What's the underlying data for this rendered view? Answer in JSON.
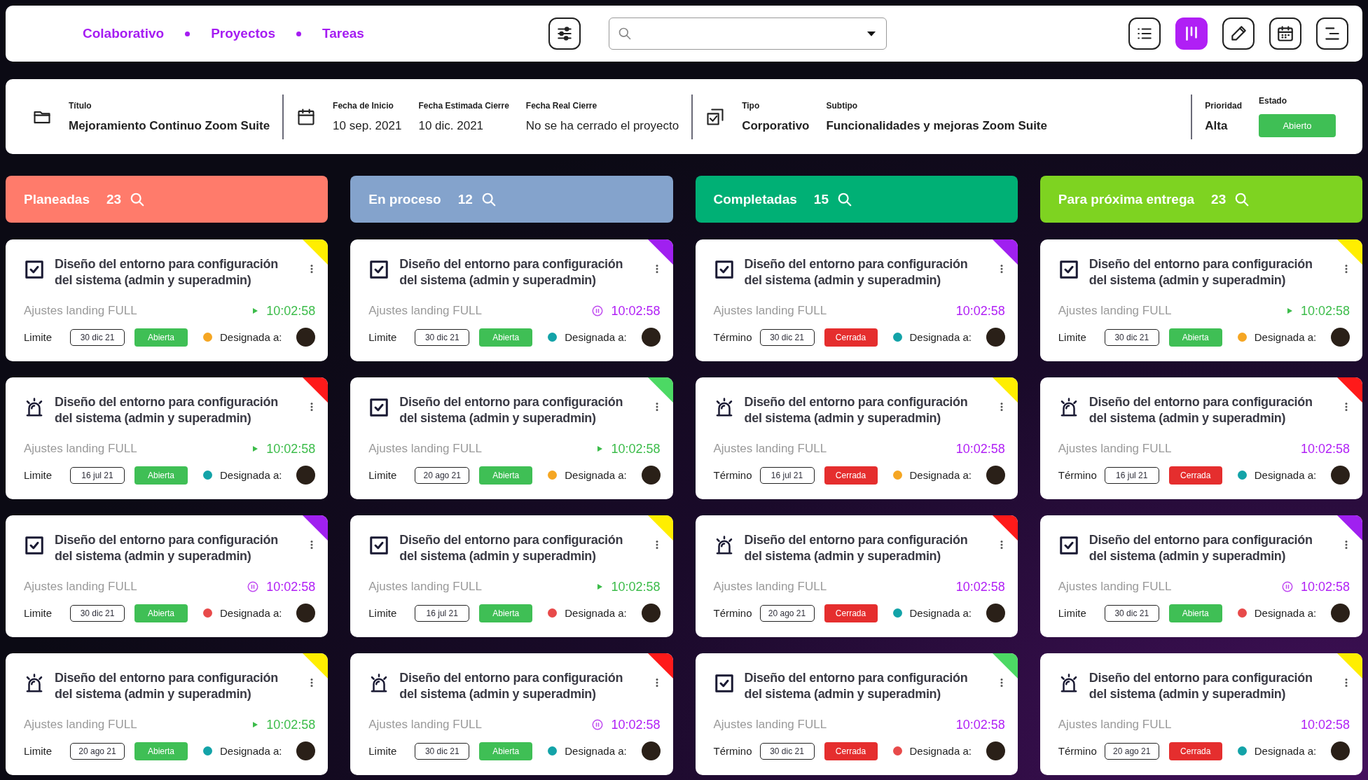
{
  "breadcrumbs": [
    {
      "label": "Colaborativo"
    },
    {
      "label": "Proyectos"
    },
    {
      "label": "Tareas"
    }
  ],
  "views": [
    {
      "kind": "list",
      "selected": false
    },
    {
      "kind": "board",
      "selected": true
    },
    {
      "kind": "edit",
      "selected": false
    },
    {
      "kind": "calendar",
      "selected": false
    },
    {
      "kind": "outline",
      "selected": false
    }
  ],
  "project": {
    "groups": [
      {
        "fields": [
          {
            "label": "Título",
            "value": "Mejoramiento Continuo Zoom Suite"
          }
        ]
      },
      {
        "fields": [
          {
            "label": "Fecha de Inicio",
            "value": "10 sep. 2021"
          },
          {
            "label": "Fecha Estimada Cierre",
            "value": "10 dic. 2021"
          },
          {
            "label": "Fecha Real Cierre",
            "value": "No se ha cerrado el proyecto"
          }
        ]
      },
      {
        "fields": [
          {
            "label": "Tipo",
            "value": "Corporativo"
          },
          {
            "label": "Subtipo",
            "value": "Funcionalidades y mejoras Zoom Suite"
          }
        ]
      },
      {
        "fields": [
          {
            "label": "Prioridad",
            "value": "Alta"
          },
          {
            "label": "Estado",
            "value": "Abierto",
            "kind": "badge"
          }
        ]
      }
    ]
  },
  "columns": [
    {
      "title": "Planeadas",
      "count": "23",
      "color": "#ff7b6b",
      "cards": [
        {
          "kind": "task",
          "flag": {
            "color": "#ffee00"
          },
          "title": "Diseño del entorno para configuración del sistema (admin y superadmin)",
          "subtitle": "Ajustes landing FULL",
          "timer": {
            "kind": "play",
            "time": "10:02:58"
          },
          "date_label": "Limite",
          "date": "30 dic 21",
          "status": {
            "kind": "open",
            "label": "Abierta"
          },
          "assignee": {
            "color": "#f5a623",
            "label": "Designada a:"
          }
        },
        {
          "kind": "alert",
          "flag": {
            "color": "#ff1a1a"
          },
          "title": "Diseño del entorno para configuración del sistema (admin y superadmin)",
          "subtitle": "Ajustes landing FULL",
          "timer": {
            "kind": "play",
            "time": "10:02:58"
          },
          "date_label": "Limite",
          "date": "16 jul 21",
          "status": {
            "kind": "open",
            "label": "Abierta"
          },
          "assignee": {
            "color": "#13a3a8",
            "label": "Designada a:"
          }
        },
        {
          "kind": "task",
          "flag": {
            "color": "#a020f0"
          },
          "title": "Diseño del entorno para configuración del sistema (admin y superadmin)",
          "subtitle": "Ajustes landing FULL",
          "timer": {
            "kind": "pause",
            "time": "10:02:58"
          },
          "date_label": "Limite",
          "date": "30 dic 21",
          "status": {
            "kind": "open",
            "label": "Abierta"
          },
          "assignee": {
            "color": "#e84a4a",
            "label": "Designada a:"
          }
        },
        {
          "kind": "alert",
          "flag": {
            "color": "#ffee00"
          },
          "title": "Diseño del entorno para configuración del sistema (admin y superadmin)",
          "subtitle": "Ajustes landing FULL",
          "timer": {
            "kind": "play",
            "time": "10:02:58"
          },
          "date_label": "Limite",
          "date": "20 ago 21",
          "status": {
            "kind": "open",
            "label": "Abierta"
          },
          "assignee": {
            "color": "#13a3a8",
            "label": "Designada a:"
          }
        }
      ]
    },
    {
      "title": "En proceso",
      "count": "12",
      "color": "#84a3cc",
      "cards": [
        {
          "kind": "task",
          "flag": {
            "color": "#a020f0"
          },
          "title": "Diseño del entorno para configuración del sistema (admin y superadmin)",
          "subtitle": "Ajustes landing FULL",
          "timer": {
            "kind": "pause",
            "time": "10:02:58"
          },
          "date_label": "Limite",
          "date": "30 dic 21",
          "status": {
            "kind": "open",
            "label": "Abierta"
          },
          "assignee": {
            "color": "#13a3a8",
            "label": "Designada a:"
          }
        },
        {
          "kind": "task",
          "flag": {
            "color": "#4cd964"
          },
          "title": "Diseño del entorno para configuración del sistema (admin y superadmin)",
          "subtitle": "Ajustes landing FULL",
          "timer": {
            "kind": "play",
            "time": "10:02:58"
          },
          "date_label": "Limite",
          "date": "20 ago 21",
          "status": {
            "kind": "open",
            "label": "Abierta"
          },
          "assignee": {
            "color": "#f5a623",
            "label": "Designada a:"
          }
        },
        {
          "kind": "task",
          "flag": {
            "color": "#ffee00"
          },
          "title": "Diseño del entorno para configuración del sistema (admin y superadmin)",
          "subtitle": "Ajustes landing FULL",
          "timer": {
            "kind": "play",
            "time": "10:02:58"
          },
          "date_label": "Limite",
          "date": "16 jul 21",
          "status": {
            "kind": "open",
            "label": "Abierta"
          },
          "assignee": {
            "color": "#e84a4a",
            "label": "Designada a:"
          }
        },
        {
          "kind": "alert",
          "flag": {
            "color": "#ff1a1a"
          },
          "title": "Diseño del entorno para configuración del sistema (admin y superadmin)",
          "subtitle": "Ajustes landing FULL",
          "timer": {
            "kind": "pause",
            "time": "10:02:58"
          },
          "date_label": "Limite",
          "date": "30 dic 21",
          "status": {
            "kind": "open",
            "label": "Abierta"
          },
          "assignee": {
            "color": "#13a3a8",
            "label": "Designada a:"
          }
        }
      ]
    },
    {
      "title": "Completadas",
      "count": "15",
      "color": "#00b075",
      "cards": [
        {
          "kind": "task",
          "flag": {
            "color": "#a020f0"
          },
          "title": "Diseño del entorno para configuración del sistema (admin y superadmin)",
          "subtitle": "Ajustes landing FULL",
          "timer": {
            "kind": "stopped",
            "time": "10:02:58"
          },
          "date_label": "Término",
          "date": "30 dic 21",
          "status": {
            "kind": "closed",
            "label": "Cerrada"
          },
          "assignee": {
            "color": "#13a3a8",
            "label": "Designada a:"
          }
        },
        {
          "kind": "alert",
          "flag": {
            "color": "#ffee00"
          },
          "title": "Diseño del entorno para configuración del sistema (admin y superadmin)",
          "subtitle": "Ajustes landing FULL",
          "timer": {
            "kind": "stopped",
            "time": "10:02:58"
          },
          "date_label": "Término",
          "date": "16 jul 21",
          "status": {
            "kind": "closed",
            "label": "Cerrada"
          },
          "assignee": {
            "color": "#f5a623",
            "label": "Designada a:"
          }
        },
        {
          "kind": "alert",
          "flag": {
            "color": "#ff1a1a"
          },
          "title": "Diseño del entorno para configuración del sistema (admin y superadmin)",
          "subtitle": "Ajustes landing FULL",
          "timer": {
            "kind": "stopped",
            "time": "10:02:58"
          },
          "date_label": "Término",
          "date": "20 ago 21",
          "status": {
            "kind": "closed",
            "label": "Cerrada"
          },
          "assignee": {
            "color": "#13a3a8",
            "label": "Designada a:"
          }
        },
        {
          "kind": "task",
          "flag": {
            "color": "#4cd964"
          },
          "title": "Diseño del entorno para configuración del sistema (admin y superadmin)",
          "subtitle": "Ajustes landing FULL",
          "timer": {
            "kind": "stopped",
            "time": "10:02:58"
          },
          "date_label": "Término",
          "date": "30 dic 21",
          "status": {
            "kind": "closed",
            "label": "Cerrada"
          },
          "assignee": {
            "color": "#e84a4a",
            "label": "Designada a:"
          }
        }
      ]
    },
    {
      "title": "Para próxima entrega",
      "count": "23",
      "color": "#7ed321",
      "cards": [
        {
          "kind": "task",
          "flag": {
            "color": "#ffee00"
          },
          "title": "Diseño del entorno para configuración del sistema (admin y superadmin)",
          "subtitle": "Ajustes landing FULL",
          "timer": {
            "kind": "play",
            "time": "10:02:58"
          },
          "date_label": "Limite",
          "date": "30 dic 21",
          "status": {
            "kind": "open",
            "label": "Abierta"
          },
          "assignee": {
            "color": "#f5a623",
            "label": "Designada a:"
          }
        },
        {
          "kind": "alert",
          "flag": {
            "color": "#ff1a1a"
          },
          "title": "Diseño del entorno para configuración del sistema (admin y superadmin)",
          "subtitle": "Ajustes landing FULL",
          "timer": {
            "kind": "stopped",
            "time": "10:02:58"
          },
          "date_label": "Término",
          "date": "16 jul 21",
          "status": {
            "kind": "closed",
            "label": "Cerrada"
          },
          "assignee": {
            "color": "#13a3a8",
            "label": "Designada a:"
          }
        },
        {
          "kind": "task",
          "flag": {
            "color": "#a020f0"
          },
          "title": "Diseño del entorno para configuración del sistema (admin y superadmin)",
          "subtitle": "Ajustes landing FULL",
          "timer": {
            "kind": "pause",
            "time": "10:02:58"
          },
          "date_label": "Limite",
          "date": "30 dic 21",
          "status": {
            "kind": "open",
            "label": "Abierta"
          },
          "assignee": {
            "color": "#e84a4a",
            "label": "Designada a:"
          }
        },
        {
          "kind": "alert",
          "flag": {
            "color": "#ffee00"
          },
          "title": "Diseño del entorno para configuración del sistema (admin y superadmin)",
          "subtitle": "Ajustes landing FULL",
          "timer": {
            "kind": "stopped",
            "time": "10:02:58"
          },
          "date_label": "Término",
          "date": "20 ago 21",
          "status": {
            "kind": "closed",
            "label": "Cerrada"
          },
          "assignee": {
            "color": "#13a3a8",
            "label": "Designada a:"
          }
        }
      ]
    }
  ]
}
